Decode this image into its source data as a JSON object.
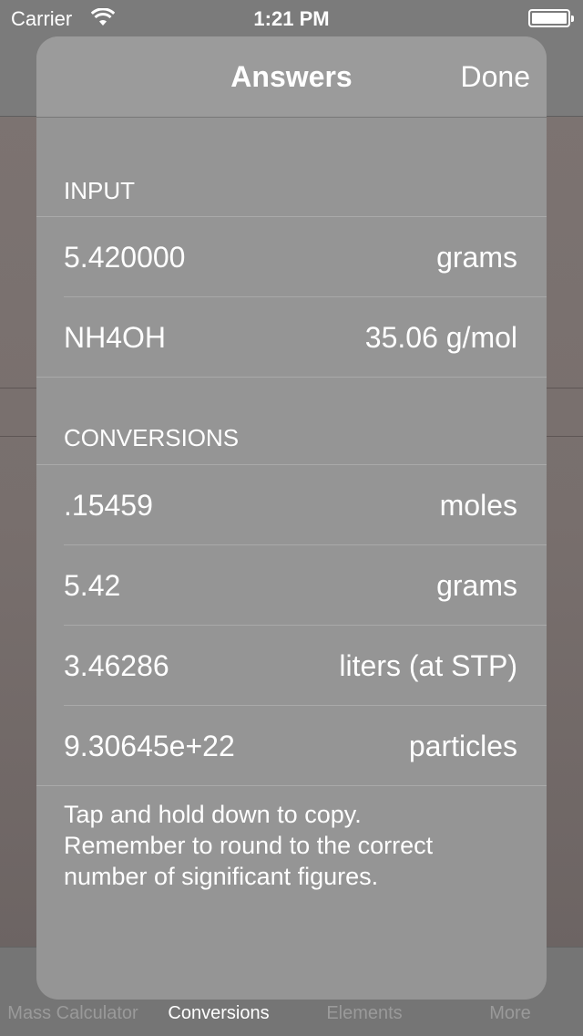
{
  "status_bar": {
    "carrier": "Carrier",
    "time": "1:21 PM"
  },
  "sheet": {
    "title": "Answers",
    "done_label": "Done"
  },
  "input_section": {
    "header": "INPUT",
    "rows": [
      {
        "value": "5.420000",
        "unit": "grams"
      },
      {
        "value": "NH4OH",
        "unit": "35.06 g/mol"
      }
    ]
  },
  "conversions_section": {
    "header": "CONVERSIONS",
    "rows": [
      {
        "value": ".15459",
        "unit": "moles"
      },
      {
        "value": "5.42",
        "unit": "grams"
      },
      {
        "value": "3.46286",
        "unit": "liters (at STP)"
      },
      {
        "value": "9.30645e+22",
        "unit": "particles"
      }
    ]
  },
  "footer": {
    "line1": "Tap and hold down to copy.",
    "line2": "Remember to round to the correct",
    "line3": "number of significant figures."
  },
  "tab_bar": {
    "tabs": [
      {
        "label": "Mass Calculator",
        "active": false
      },
      {
        "label": "Conversions",
        "active": true
      },
      {
        "label": "Elements",
        "active": false
      },
      {
        "label": "More",
        "active": false
      }
    ]
  }
}
